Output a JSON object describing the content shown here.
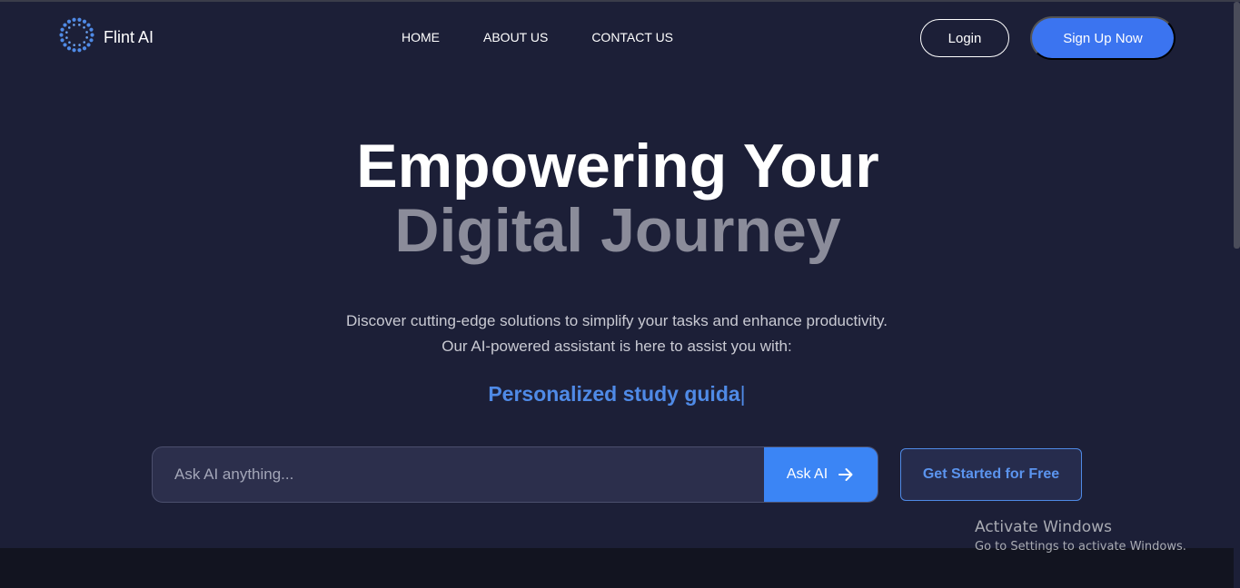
{
  "header": {
    "logo_icon": "dotted-circle-logo-icon",
    "logo_text": "Flint AI",
    "nav": [
      {
        "label": "HOME"
      },
      {
        "label": "ABOUT US"
      },
      {
        "label": "CONTACT US"
      }
    ],
    "login_label": "Login",
    "signup_label": "Sign Up Now"
  },
  "hero": {
    "title_line1": "Empowering Your",
    "title_line2": "Digital Journey",
    "description_line1": "Discover cutting-edge solutions to simplify your tasks and enhance productivity.",
    "description_line2": "Our AI-powered assistant is here to assist you with:",
    "typing_text": "Personalized study guida",
    "typing_cursor": "|"
  },
  "ask": {
    "placeholder": "Ask AI anything...",
    "button_label": "Ask AI",
    "button_icon": "arrow-right-icon"
  },
  "cta": {
    "get_started_label": "Get Started for Free"
  },
  "windows_watermark": {
    "title": "Activate Windows",
    "subtitle": "Go to Settings to activate Windows."
  },
  "colors": {
    "background": "#1c1f37",
    "accent": "#3b74f0",
    "highlight_text": "#4f8ae6",
    "muted_heading": "#8b8c9a"
  }
}
